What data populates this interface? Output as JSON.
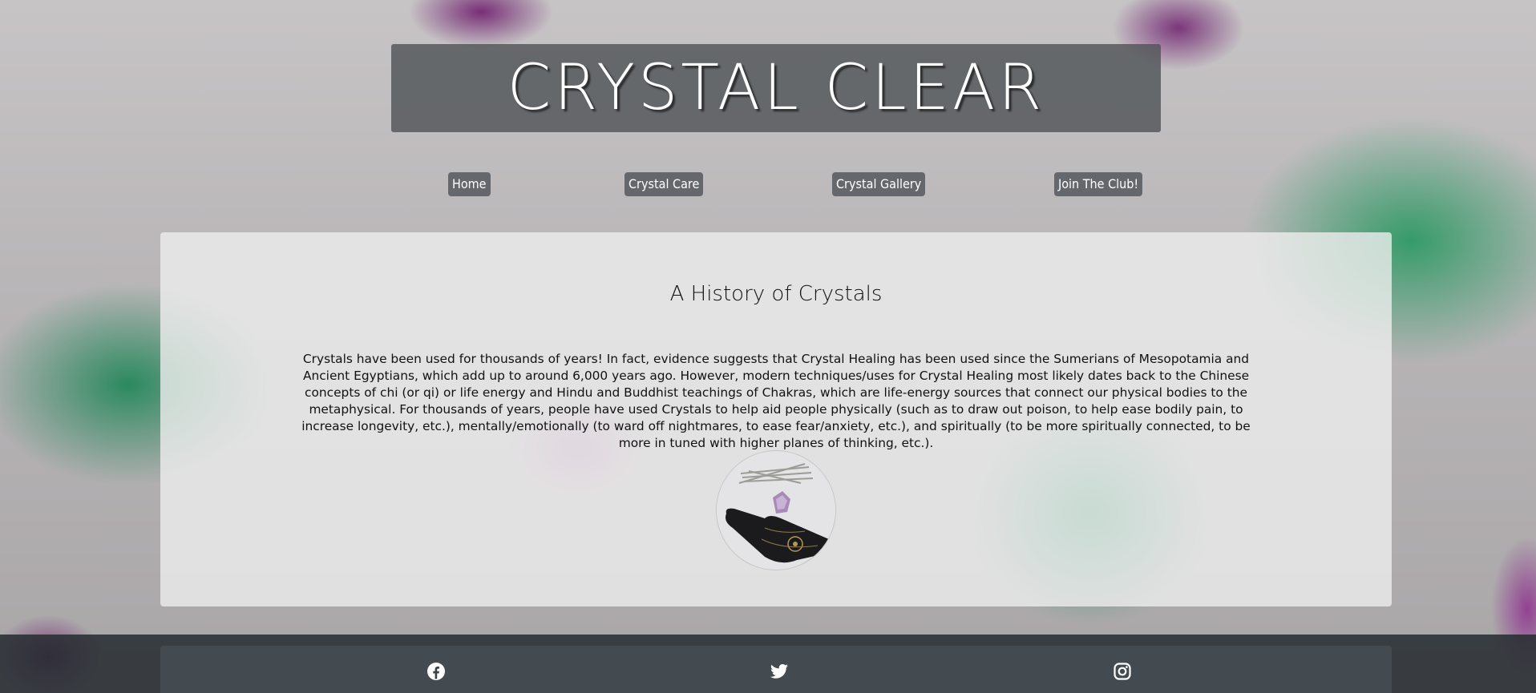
{
  "header": {
    "title": "CRYSTAL CLEAR"
  },
  "nav": {
    "items": [
      {
        "label": "Home"
      },
      {
        "label": "Crystal Care"
      },
      {
        "label": "Crystal Gallery"
      },
      {
        "label": "Join The Club!"
      }
    ]
  },
  "main": {
    "heading": "A History of Crystals",
    "paragraph": "Crystals have been used for thousands of years! In fact, evidence suggests that Crystal Healing has been used since the Sumerians of Mesopotamia and Ancient Egyptians, which add up to around 6,000 years ago. However, modern techniques/uses for Crystal Healing most likely dates back to the Chinese concepts of chi (or qi) or life energy and Hindu and Buddhist teachings of Chakras, which are life-energy sources that connect our physical bodies to the metaphysical. For thousands of years, people have used Crystals to help aid people physically (such as to draw out poison, to help ease bodily pain, to increase longevity, etc.), mentally/emotionally (to ward off nightmares, to ease fear/anxiety, etc.), and spiritually (to be more spiritually connected, to be more in tuned with higher planes of thinking, etc.)."
  },
  "footer": {
    "icons": [
      "facebook-icon",
      "twitter-icon",
      "instagram-icon"
    ]
  },
  "colors": {
    "title_box": "#505458",
    "nav_button": "#5f6367",
    "content_panel": "#f0f0f0",
    "footer": "#282e32",
    "text_dark": "#111111",
    "text_light": "#ffffff"
  }
}
